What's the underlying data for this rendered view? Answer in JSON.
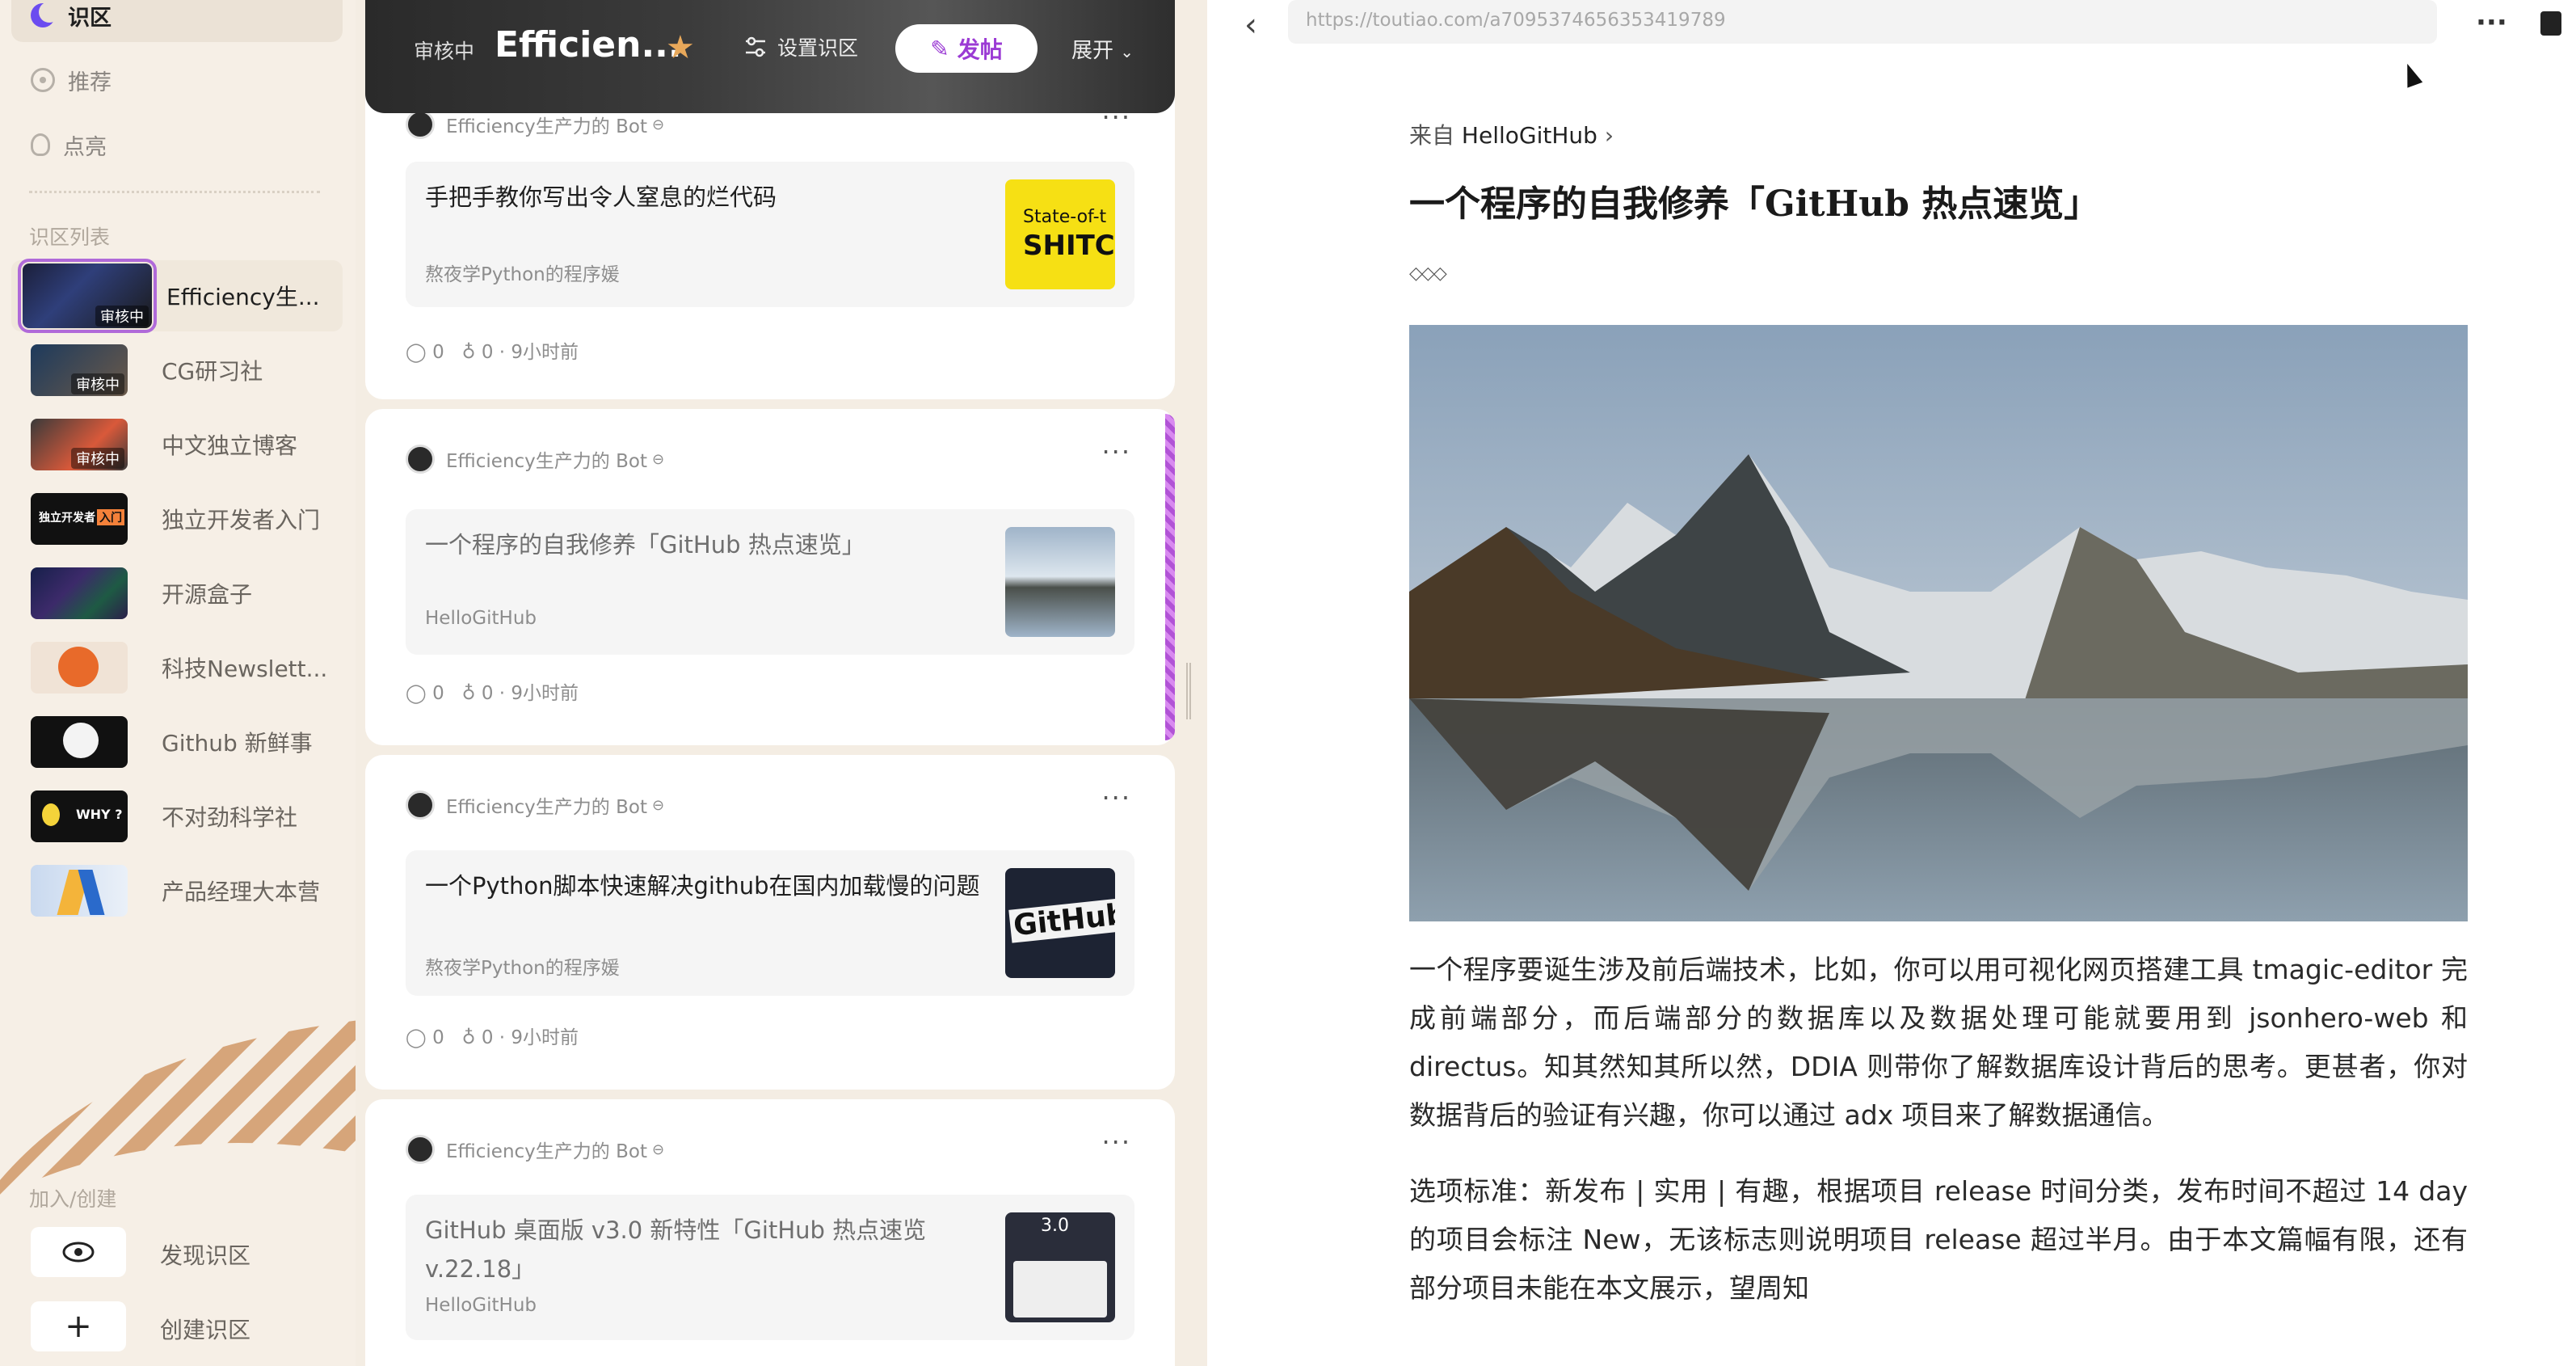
{
  "sidebar": {
    "nav": [
      {
        "label": "识区",
        "icon": "moon-icon",
        "active": true
      },
      {
        "label": "推荐",
        "icon": "compass-icon",
        "active": false
      },
      {
        "label": "点亮",
        "icon": "bulb-icon",
        "active": false
      }
    ],
    "list_label": "识区列表",
    "circles": [
      {
        "name": "Efficiency生...",
        "badge": "审核中",
        "active": true
      },
      {
        "name": "CG研习社",
        "badge": "审核中"
      },
      {
        "name": "中文独立博客",
        "badge": "审核中"
      },
      {
        "name": "独立开发者入门",
        "badge": ""
      },
      {
        "name": "开源盒子",
        "badge": ""
      },
      {
        "name": "科技Newslett...",
        "badge": ""
      },
      {
        "name": "Github 新鲜事",
        "badge": ""
      },
      {
        "name": "不对劲科学社",
        "badge": ""
      },
      {
        "name": "产品经理大本营",
        "badge": ""
      }
    ],
    "join_label": "加入/创建",
    "discover_label": "发现识区",
    "create_label": "创建识区"
  },
  "feed": {
    "header": {
      "badge": "审核中",
      "title": "Efficien...",
      "settings_label": "设置识区",
      "post_label": "发帖",
      "expand_label": "展开"
    },
    "cards": [
      {
        "author": "Efficiency生产力的 Bot",
        "title": "手把手教你写出令人窒息的烂代码",
        "source": "熬夜学Python的程序媛",
        "comments": "0",
        "likes": "0",
        "time": "9小时前",
        "thumb_text_1": "State-of-t",
        "thumb_text_2": "SHITC"
      },
      {
        "author": "Efficiency生产力的 Bot",
        "title": "一个程序的自我修养「GitHub 热点速览」",
        "source": "HelloGitHub",
        "comments": "0",
        "likes": "0",
        "time": "9小时前"
      },
      {
        "author": "Efficiency生产力的 Bot",
        "title": "一个Python脚本快速解决github在国内加载慢的问题",
        "source": "熬夜学Python的程序媛",
        "comments": "0",
        "likes": "0",
        "time": "9小时前",
        "thumb_text_1": "GitHub"
      },
      {
        "author": "Efficiency生产力的 Bot",
        "title": "GitHub 桌面版 v3.0 新特性「GitHub 热点速览 v.22.18」",
        "source": "HelloGitHub",
        "thumb_text_1": "3.0"
      }
    ],
    "stat_sep": "·"
  },
  "reader": {
    "url": "https://toutiao.com/a7095374656353419789",
    "from_prefix": "来自",
    "from_source": "HelloGitHub",
    "title": "一个程序的自我修养「GitHub 热点速览」",
    "paragraphs": [
      "一个程序要诞生涉及前后端技术，比如，你可以用可视化网页搭建工具 tmagic-editor 完成前端部分，而后端部分的数据库以及数据处理可能就要用到 jsonhero-web 和 directus。知其然知其所以然，DDIA 则带你了解数据库设计背后的思考。更甚者，你对数据背后的验证有兴趣，你可以通过 adx 项目来了解数据通信。",
      "选项标准：新发布 | 实用 | 有趣，根据项目 release 时间分类，发布时间不超过 14 day 的项目会标注 New，无该标志则说明项目 release 超过半月。由于本文篇幅有限，还有部分项目未能在本文展示，望周知"
    ]
  },
  "colors": {
    "accent": "#9b3bd4",
    "star": "#e8a85a"
  }
}
